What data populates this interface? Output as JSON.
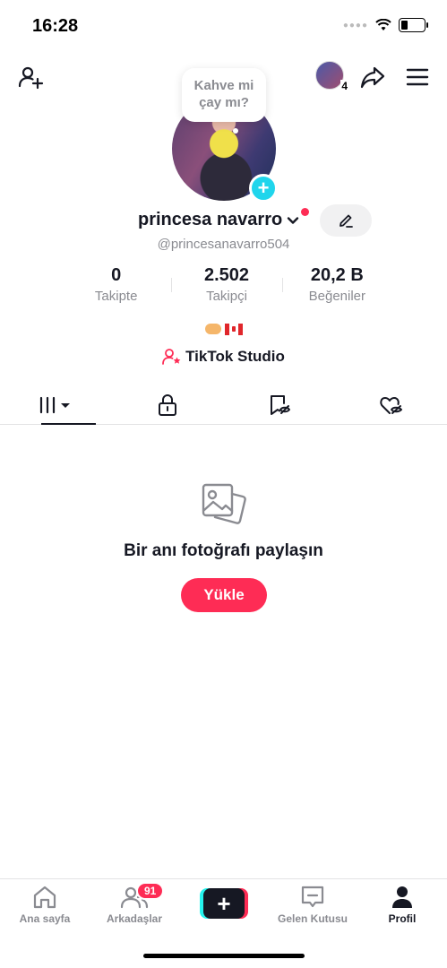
{
  "status_bar": {
    "time": "16:28",
    "battery_level": 0.3,
    "icons": [
      "signal-icon",
      "wifi-icon",
      "battery-icon"
    ]
  },
  "top_nav": {
    "icons": [
      "add-friend-icon",
      "share-icon",
      "menu-icon"
    ],
    "notification_count": "4"
  },
  "profile": {
    "note_bubble": "Kahve mi çay mı?",
    "username": "princesa navarro",
    "handle": "@princesanavarro504",
    "bio_emojis": [
      "heart-hands-emoji",
      "canada-flag-emoji"
    ],
    "studio_label": "TikTok Studio"
  },
  "stats": [
    {
      "value": "0",
      "label": "Takipte"
    },
    {
      "value": "2.502",
      "label": "Takipçi"
    },
    {
      "value": "20,2 B",
      "label": "Beğeniler"
    }
  ],
  "tabs": [
    {
      "name": "videos",
      "icon": "grid-icon",
      "active": true
    },
    {
      "name": "private",
      "icon": "lock-icon",
      "active": false
    },
    {
      "name": "saved",
      "icon": "bookmark-hidden-icon",
      "active": false
    },
    {
      "name": "liked",
      "icon": "heart-hidden-icon",
      "active": false
    }
  ],
  "empty_state": {
    "title": "Bir anı fotoğrafı paylaşın",
    "button": "Yükle"
  },
  "bottom_nav": [
    {
      "label": "Ana sayfa",
      "icon": "home-icon"
    },
    {
      "label": "Arkadaşlar",
      "icon": "friends-icon",
      "badge": "91"
    },
    {
      "label": "",
      "icon": "create-icon"
    },
    {
      "label": "Gelen Kutusu",
      "icon": "inbox-icon"
    },
    {
      "label": "Profil",
      "icon": "profile-icon",
      "active": true
    }
  ],
  "colors": {
    "accent": "#fe2c55",
    "cyan": "#20d5ec",
    "text": "#161823",
    "muted": "#8a8b91"
  }
}
